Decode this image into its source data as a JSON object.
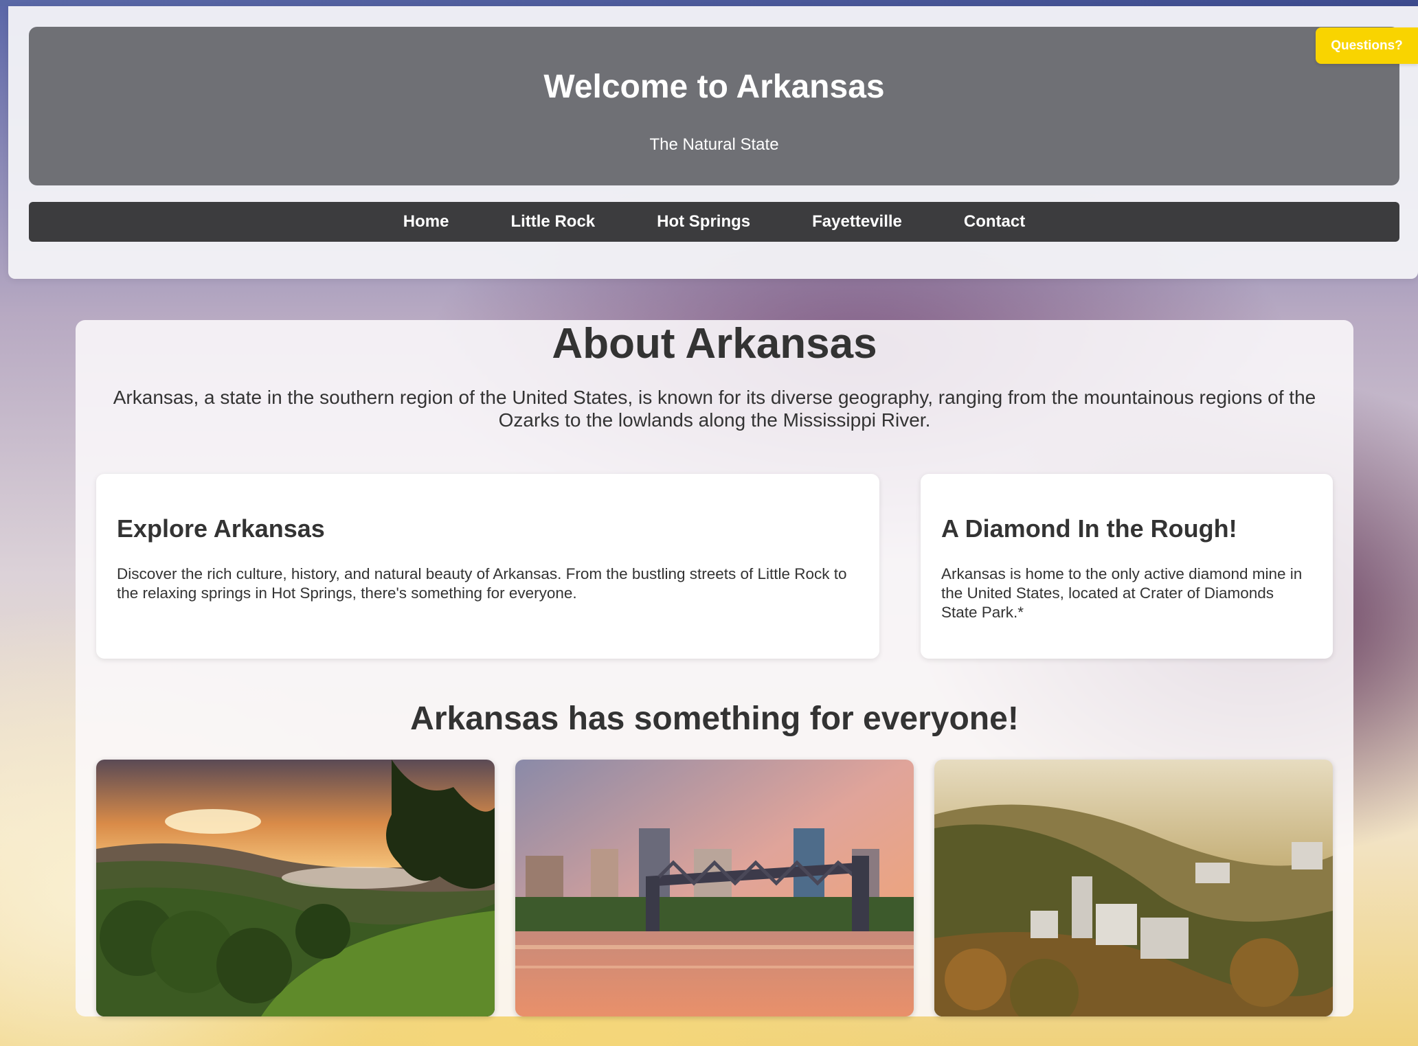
{
  "header": {
    "title": "Welcome to Arkansas",
    "tagline": "The Natural State"
  },
  "nav": {
    "items": [
      "Home",
      "Little Rock",
      "Hot Springs",
      "Fayetteville",
      "Contact"
    ]
  },
  "questions_button": "Questions?",
  "about": {
    "heading": "About Arkansas",
    "intro": "Arkansas, a state in the southern region of the United States, is known for its diverse geography, ranging from the mountainous regions of the Ozarks to the lowlands along the Mississippi River."
  },
  "cards": [
    {
      "title": "Explore Arkansas",
      "text": "Discover the rich culture, history, and natural beauty of Arkansas. From the bustling streets of Little Rock to the relaxing springs in Hot Springs, there's something for everyone."
    },
    {
      "title": "A Diamond In the Rough!",
      "text": "Arkansas is home to the only active diamond mine in the United States, located at Crater of Diamonds State Park.*"
    }
  ],
  "gallery": {
    "heading": "Arkansas has something for everyone!",
    "images": [
      "ozark-sunrise-landscape",
      "little-rock-skyline-bridge",
      "hot-springs-aerial-town"
    ]
  },
  "colors": {
    "hero_bg": "#6f7075",
    "nav_bg": "#3c3c3e",
    "questions_bg": "#f9d400",
    "text_dark": "#333333"
  }
}
